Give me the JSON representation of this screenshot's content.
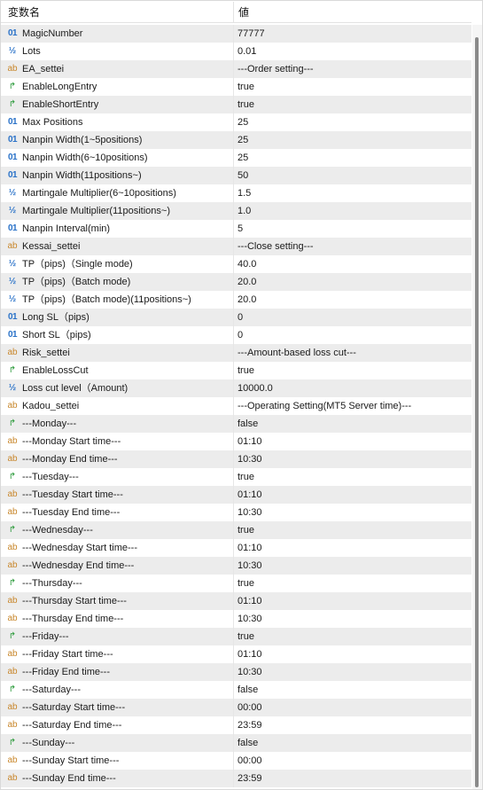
{
  "header": {
    "name_col": "変数名",
    "value_col": "値"
  },
  "rows": [
    {
      "type": "int",
      "icon": "01",
      "name": "MagicNumber",
      "value": "77777"
    },
    {
      "type": "double",
      "icon": "½",
      "name": "Lots",
      "value": "0.01"
    },
    {
      "type": "string",
      "icon": "ab",
      "name": "EA_settei",
      "value": "---Order setting---"
    },
    {
      "type": "bool",
      "icon": "↱",
      "name": "EnableLongEntry",
      "value": "true"
    },
    {
      "type": "bool",
      "icon": "↱",
      "name": "EnableShortEntry",
      "value": "true"
    },
    {
      "type": "int",
      "icon": "01",
      "name": "Max Positions",
      "value": "25"
    },
    {
      "type": "int",
      "icon": "01",
      "name": "Nanpin Width(1~5positions)",
      "value": "25"
    },
    {
      "type": "int",
      "icon": "01",
      "name": "Nanpin Width(6~10positions)",
      "value": "25"
    },
    {
      "type": "int",
      "icon": "01",
      "name": "Nanpin Width(11positions~)",
      "value": "50"
    },
    {
      "type": "double",
      "icon": "½",
      "name": "Martingale Multiplier(6~10positions)",
      "value": "1.5"
    },
    {
      "type": "double",
      "icon": "½",
      "name": "Martingale Multiplier(11positions~)",
      "value": "1.0"
    },
    {
      "type": "int",
      "icon": "01",
      "name": "Nanpin Interval(min)",
      "value": "5"
    },
    {
      "type": "string",
      "icon": "ab",
      "name": "Kessai_settei",
      "value": "---Close setting---"
    },
    {
      "type": "double",
      "icon": "½",
      "name": "TP（pips)（Single mode)",
      "value": "40.0"
    },
    {
      "type": "double",
      "icon": "½",
      "name": "TP（pips)（Batch mode)",
      "value": "20.0"
    },
    {
      "type": "double",
      "icon": "½",
      "name": "TP（pips)（Batch mode)(11positions~)",
      "value": "20.0"
    },
    {
      "type": "int",
      "icon": "01",
      "name": "Long SL（pips)",
      "value": "0"
    },
    {
      "type": "int",
      "icon": "01",
      "name": "Short SL（pips)",
      "value": "0"
    },
    {
      "type": "string",
      "icon": "ab",
      "name": "Risk_settei",
      "value": "---Amount-based loss cut---"
    },
    {
      "type": "bool",
      "icon": "↱",
      "name": "EnableLossCut",
      "value": "true"
    },
    {
      "type": "double",
      "icon": "½",
      "name": "Loss cut level（Amount)",
      "value": "10000.0"
    },
    {
      "type": "string",
      "icon": "ab",
      "name": "Kadou_settei",
      "value": "---Operating Setting(MT5 Server time)---"
    },
    {
      "type": "bool",
      "icon": "↱",
      "name": "---Monday---",
      "value": "false"
    },
    {
      "type": "string",
      "icon": "ab",
      "name": "---Monday Start time---",
      "value": "01:10"
    },
    {
      "type": "string",
      "icon": "ab",
      "name": "---Monday End time---",
      "value": "10:30"
    },
    {
      "type": "bool",
      "icon": "↱",
      "name": "---Tuesday---",
      "value": "true"
    },
    {
      "type": "string",
      "icon": "ab",
      "name": "---Tuesday Start time---",
      "value": "01:10"
    },
    {
      "type": "string",
      "icon": "ab",
      "name": "---Tuesday End time---",
      "value": "10:30"
    },
    {
      "type": "bool",
      "icon": "↱",
      "name": "---Wednesday---",
      "value": "true"
    },
    {
      "type": "string",
      "icon": "ab",
      "name": "---Wednesday Start time---",
      "value": "01:10"
    },
    {
      "type": "string",
      "icon": "ab",
      "name": "---Wednesday End time---",
      "value": "10:30"
    },
    {
      "type": "bool",
      "icon": "↱",
      "name": "---Thursday---",
      "value": "true"
    },
    {
      "type": "string",
      "icon": "ab",
      "name": "---Thursday Start time---",
      "value": "01:10"
    },
    {
      "type": "string",
      "icon": "ab",
      "name": "---Thursday End time---",
      "value": "10:30"
    },
    {
      "type": "bool",
      "icon": "↱",
      "name": "---Friday---",
      "value": "true"
    },
    {
      "type": "string",
      "icon": "ab",
      "name": "---Friday Start time---",
      "value": "01:10"
    },
    {
      "type": "string",
      "icon": "ab",
      "name": "---Friday End time---",
      "value": "10:30"
    },
    {
      "type": "bool",
      "icon": "↱",
      "name": "---Saturday---",
      "value": "false"
    },
    {
      "type": "string",
      "icon": "ab",
      "name": "---Saturday Start time---",
      "value": "00:00"
    },
    {
      "type": "string",
      "icon": "ab",
      "name": "---Saturday End time---",
      "value": "23:59"
    },
    {
      "type": "bool",
      "icon": "↱",
      "name": "---Sunday---",
      "value": "false"
    },
    {
      "type": "string",
      "icon": "ab",
      "name": "---Sunday Start time---",
      "value": "00:00"
    },
    {
      "type": "string",
      "icon": "ab",
      "name": "---Sunday End time---",
      "value": "23:59"
    }
  ],
  "colors": {
    "row_alt": "#ececec",
    "int_icon": "#2a72c8",
    "string_icon": "#c8862a",
    "bool_icon": "#2a9a3a"
  }
}
